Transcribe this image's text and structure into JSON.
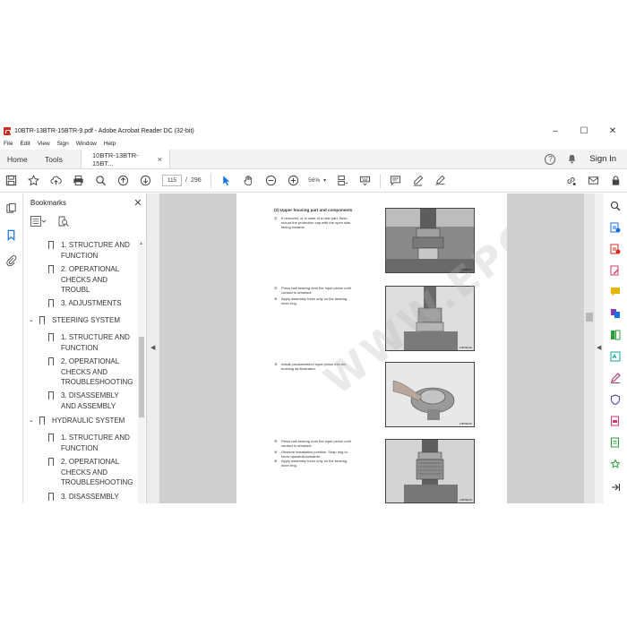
{
  "window": {
    "title": "10BTR-13BTR-15BTR-9.pdf - Adobe Acrobat Reader DC (32-bit)",
    "minimize": "–",
    "maximize": "☐",
    "close": "✕"
  },
  "menu": [
    "File",
    "Edit",
    "View",
    "Sign",
    "Window",
    "Help"
  ],
  "tabs": {
    "home": "Home",
    "tools": "Tools",
    "doc": "10BTR-13BTR-15BT...",
    "doc_close": "×",
    "sign_in": "Sign In",
    "help": "?"
  },
  "toolbar": {
    "page_current": "115",
    "page_sep": "/",
    "page_total": "296",
    "zoom": "56%"
  },
  "bookmarks": {
    "title": "Bookmarks",
    "close": "✕",
    "items": [
      {
        "line1": "1. STRUCTURE AND",
        "line2": "FUNCTION"
      },
      {
        "line1": "2. OPERATIONAL",
        "line2": "CHECKS AND",
        "line3": "TROUBL"
      },
      {
        "line1": "3. ADJUSTMENTS"
      },
      {
        "line1": "STEERING SYSTEM"
      },
      {
        "line1": "1. STRUCTURE AND",
        "line2": "FUNCTION"
      },
      {
        "line1": "2. OPERATIONAL",
        "line2": "CHECKS AND",
        "line3": "TROUBLESHOOTING"
      },
      {
        "line1": "3. DISASSEMBLY",
        "line2": "AND ASSEMBLY"
      },
      {
        "line1": "HYDRAULIC SYSTEM"
      },
      {
        "line1": "1. STRUCTURE AND",
        "line2": "FUNCTION"
      },
      {
        "line1": "2. OPERATIONAL",
        "line2": "CHECKS AND",
        "line3": "TROUBLESHOOTING"
      },
      {
        "line1": "3. DISASSEMBLY"
      }
    ]
  },
  "page": {
    "heading": "(2) Upper housing part and components",
    "steps": [
      {
        "num": "①",
        "lines": [
          "If removed, or in case of a new part, flush-",
          "mount the protection cap with the open side",
          "facing inwards."
        ],
        "fig": "10BT9EX01"
      },
      {
        "num": "②",
        "lines": [
          "Press ball bearing onto the input pinion until",
          "contact is obtained."
        ],
        "notes": [
          "Apply assembly force only on the bearing",
          "inner ring."
        ],
        "fig": "10BT9EX02"
      },
      {
        "num": "③",
        "lines": [
          "Install preassembled input pinion into the",
          "bushing as illustrated."
        ],
        "fig": "10BT9EX03"
      },
      {
        "num": "④",
        "lines": [
          "Press ball bearing onto the input pinion until",
          "contact is obtained."
        ],
        "notes": [
          "Observe installation position. Snap ring to",
          "show upwards/outwards.",
          "Apply assembly force only on the bearing",
          "inner ring."
        ],
        "fig": "10BT9EX04"
      }
    ],
    "note_mark": "※",
    "watermark": "WWW.EPCDEPO.COM"
  },
  "colors": {
    "accent": "#1473e6",
    "pdf_red": "#d42b20",
    "doc_bg": "#cfcfcf"
  }
}
